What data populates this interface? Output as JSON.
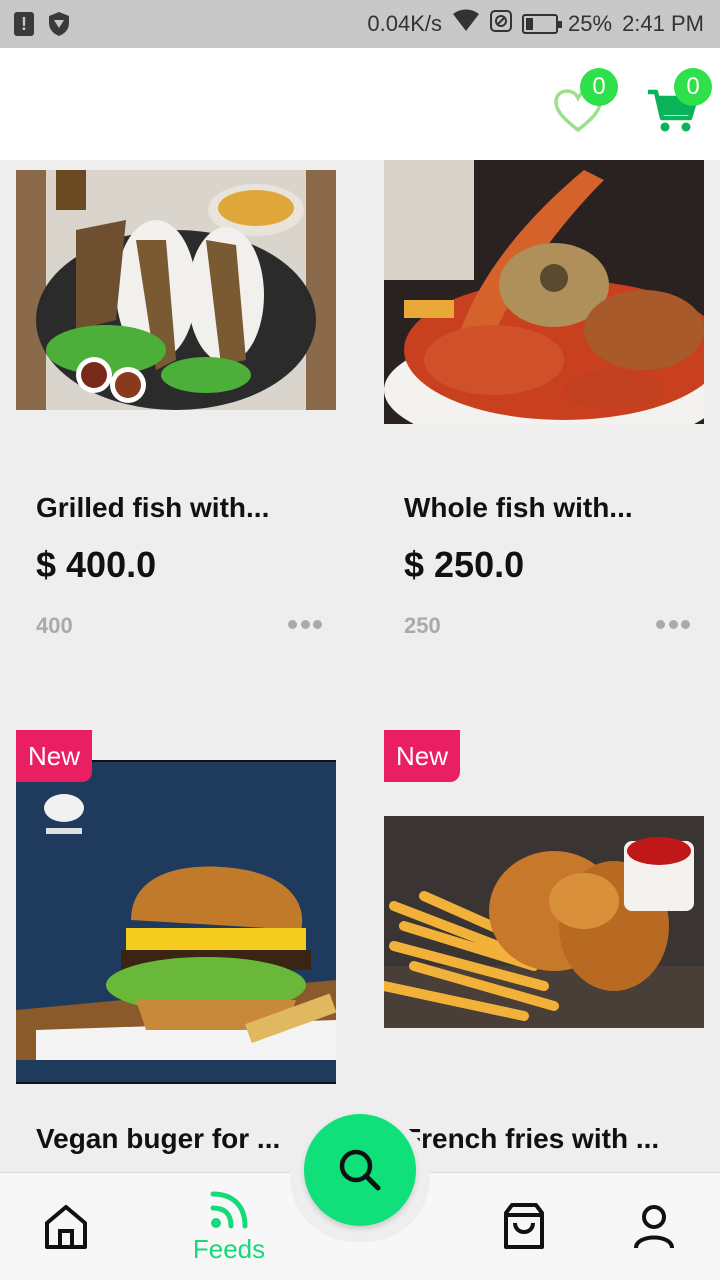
{
  "status_bar": {
    "speed": "0.04K/s",
    "battery": "25%",
    "battery_level": 0.25,
    "time": "2:41 PM"
  },
  "header": {
    "wishlist_count": "0",
    "cart_count": "0"
  },
  "products": [
    {
      "name": "Grilled fish with...",
      "price": "$ 400.0",
      "quantity": "400",
      "badge": ""
    },
    {
      "name": "Whole fish with...",
      "price": "$ 250.0",
      "quantity": "250",
      "badge": ""
    },
    {
      "name": "Vegan buger for ...",
      "badge": "New"
    },
    {
      "name": "French fries with ...",
      "badge": "New"
    }
  ],
  "bottom_nav": {
    "feeds_label": "Feeds"
  },
  "colors": {
    "accent": "#0fe07a",
    "badge_green": "#2ee04a",
    "new_badge": "#e91e63"
  }
}
